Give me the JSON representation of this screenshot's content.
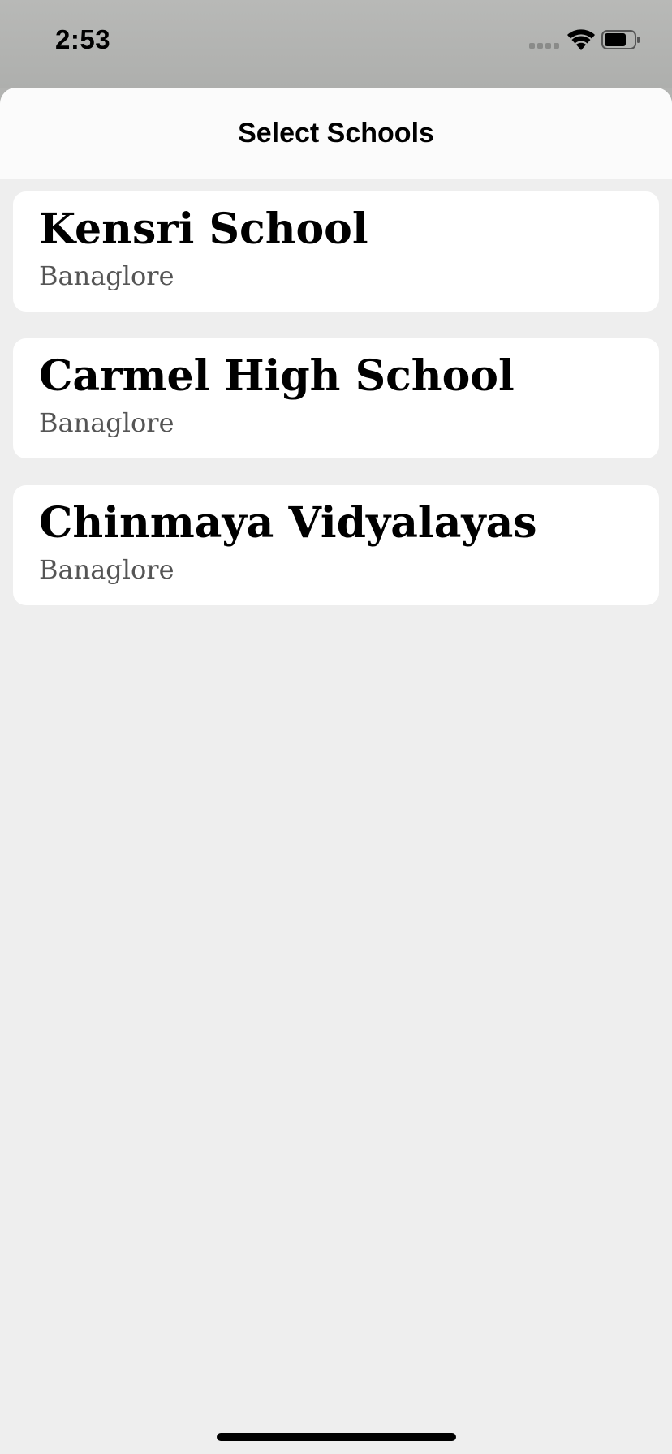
{
  "status_bar": {
    "time": "2:53",
    "icons": [
      "signal-icon",
      "wifi-icon",
      "battery-icon"
    ]
  },
  "header": {
    "title": "Select Schools"
  },
  "schools": [
    {
      "name": "Kensri School",
      "city": "Banaglore"
    },
    {
      "name": "Carmel High School",
      "city": "Banaglore"
    },
    {
      "name": "Chinmaya Vidyalayas",
      "city": "Banaglore"
    }
  ],
  "colors": {
    "status_bar_bg": "#b2b3b1",
    "sheet_bg": "#eeeeee",
    "header_bg": "#fbfbfb",
    "card_bg": "#ffffff",
    "subtitle_text": "#555555"
  }
}
